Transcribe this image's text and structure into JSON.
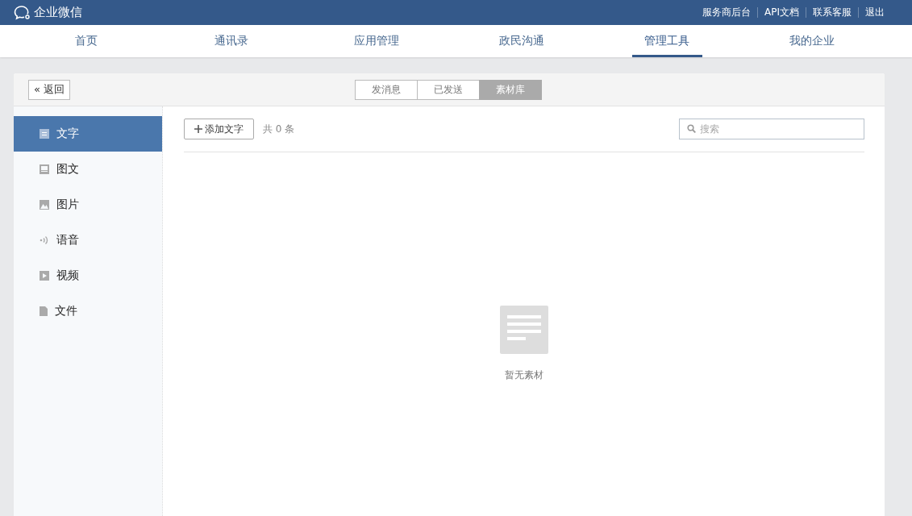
{
  "brand": {
    "name": "企业微信"
  },
  "top_links": [
    "服务商后台",
    "API文档",
    "联系客服",
    "退出"
  ],
  "nav": [
    {
      "label": "首页",
      "selected": false
    },
    {
      "label": "通讯录",
      "selected": false
    },
    {
      "label": "应用管理",
      "selected": false
    },
    {
      "label": "政民沟通",
      "selected": false
    },
    {
      "label": "管理工具",
      "selected": true
    },
    {
      "label": "我的企业",
      "selected": false
    }
  ],
  "back_button": {
    "icon": "«",
    "label": "返回"
  },
  "segments": [
    {
      "label": "发消息",
      "selected": false
    },
    {
      "label": "已发送",
      "selected": false
    },
    {
      "label": "素材库",
      "selected": true
    }
  ],
  "sidebar": {
    "items": [
      {
        "label": "文字",
        "kind": "text",
        "selected": true
      },
      {
        "label": "图文",
        "kind": "article",
        "selected": false
      },
      {
        "label": "图片",
        "kind": "image",
        "selected": false
      },
      {
        "label": "语音",
        "kind": "voice",
        "selected": false
      },
      {
        "label": "视频",
        "kind": "video",
        "selected": false
      },
      {
        "label": "文件",
        "kind": "file",
        "selected": false
      }
    ]
  },
  "toolbar": {
    "add_button": "添加文字",
    "count": "共 0 条",
    "search": {
      "placeholder": "搜索"
    }
  },
  "empty_state": {
    "message": "暂无素材"
  }
}
